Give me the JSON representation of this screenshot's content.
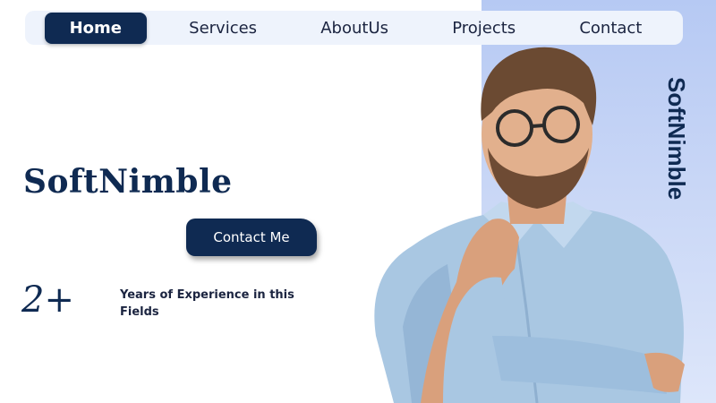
{
  "nav": {
    "items": [
      {
        "label": "Home",
        "active": true
      },
      {
        "label": "Services",
        "active": false
      },
      {
        "label": "AboutUs",
        "active": false
      },
      {
        "label": "Projects",
        "active": false
      },
      {
        "label": "Contact",
        "active": false
      }
    ]
  },
  "hero": {
    "brand_title": "SoftNimble",
    "cta_label": "Contact Me",
    "stat_value": "2+",
    "stat_label": "Years of Experience in this Fields",
    "vertical_brand": "SoftNimble"
  },
  "colors": {
    "primary": "#0f2a52",
    "nav_background": "#eef3fc",
    "panel_gradient_top": "#b6c9f3",
    "panel_gradient_bottom": "#dde6fa"
  },
  "images": {
    "hero_photo": "thinking-man-with-glasses"
  }
}
